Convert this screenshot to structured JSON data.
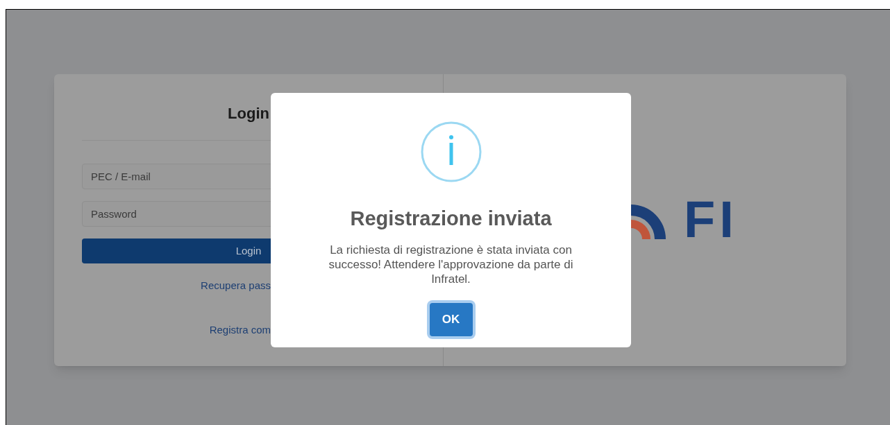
{
  "login": {
    "title": "Login",
    "fields": [
      {
        "placeholder": "PEC / E-mail"
      },
      {
        "placeholder": "Password"
      }
    ],
    "button": "Login",
    "links": [
      "Recupera pass",
      "Registra com"
    ]
  },
  "logo": {
    "text": "FI"
  },
  "dialog": {
    "title": "Registrazione inviata",
    "message": "La richiesta di registrazione è stata inviata con successo! Attendere l'approvazione da parte di Infratel.",
    "button": "OK"
  }
}
